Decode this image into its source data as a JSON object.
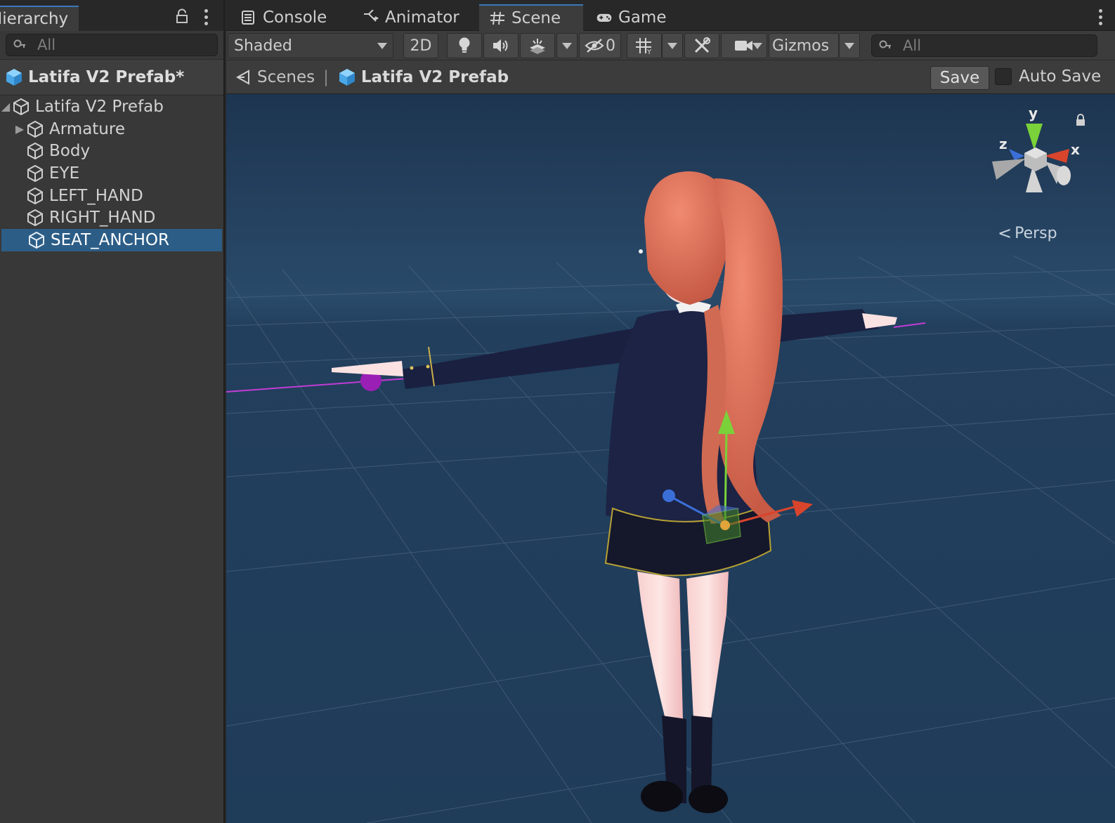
{
  "hierarchy": {
    "tab_label": "Hierarchy",
    "search_placeholder": "All",
    "header_title": "Latifa V2 Prefab*",
    "tree": [
      {
        "label": "Latifa V2 Prefab",
        "level": 0,
        "expanded": true
      },
      {
        "label": "Armature",
        "level": 1,
        "has_children": true
      },
      {
        "label": "Body",
        "level": 1
      },
      {
        "label": "EYE",
        "level": 1
      },
      {
        "label": "LEFT_HAND",
        "level": 1
      },
      {
        "label": "RIGHT_HAND",
        "level": 1
      },
      {
        "label": "SEAT_ANCHOR",
        "level": 1,
        "selected": true
      }
    ]
  },
  "tabs": {
    "console": "Console",
    "animator": "Animator",
    "scene": "Scene",
    "game": "Game",
    "active": "Scene"
  },
  "toolbar": {
    "shading_mode": "Shaded",
    "mode_2d": "2D",
    "hidden_count": "0",
    "gizmos": "Gizmos",
    "search_placeholder": "All"
  },
  "breadcrumb": {
    "scenes": "Scenes",
    "prefab": "Latifa V2 Prefab",
    "save": "Save",
    "auto_save": "Auto Save"
  },
  "viewport": {
    "projection": "Persp",
    "gizmo_axes": {
      "y": "y",
      "x": "x",
      "z": "z"
    },
    "background_color": "#203a55",
    "selection_color": "#2c5d87"
  }
}
